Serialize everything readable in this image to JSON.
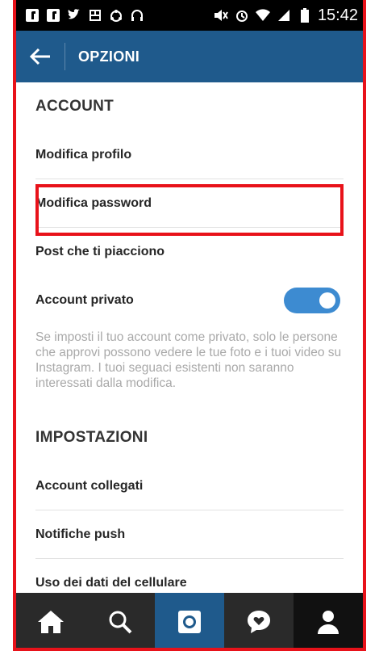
{
  "statusbar": {
    "left_icons": [
      "facebook-icon",
      "facebook-icon",
      "twitter-icon",
      "photo-icon",
      "ubuntu-icon",
      "headphones-icon"
    ],
    "right_icons": [
      "mute-icon",
      "alarm-icon",
      "wifi-icon",
      "signal-icon",
      "battery-icon"
    ],
    "time": "15:42"
  },
  "appbar": {
    "title": "OPZIONI",
    "background": "#1f5a8c"
  },
  "sections": {
    "account": {
      "header": "ACCOUNT",
      "items": [
        "Modifica profilo",
        "Modifica password",
        "Post che ti piacciono"
      ],
      "private_label": "Account privato",
      "private_enabled": true,
      "private_description": "Se imposti il tuo account come privato, solo le persone che approvi possono vedere le tue foto e i tuoi video su Instagram. I tuoi seguaci esistenti non saranno interessati dalla modifica."
    },
    "settings": {
      "header": "IMPOSTAZIONI",
      "items": [
        "Account collegati",
        "Notifiche push",
        "Uso dei dati del cellulare"
      ]
    }
  },
  "tabbar": {
    "tabs": [
      "home-icon",
      "search-icon",
      "camera-icon",
      "activity-icon",
      "profile-icon"
    ],
    "active_tab": "camera-icon"
  },
  "colors": {
    "accent": "#1f5a8c",
    "toggle_on": "#3d8bd1",
    "highlight": "#e8121a"
  }
}
